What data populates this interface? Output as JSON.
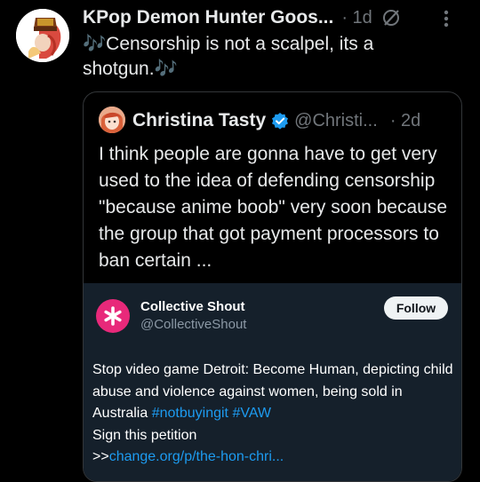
{
  "post": {
    "author_name": "KPop Demon Hunter Goos...",
    "time": "· 1d",
    "text": "🎶Censorship is not a scalpel, its a shotgun.🎶",
    "icons": {
      "grok": "grok-icon",
      "more": "more-icon"
    }
  },
  "quote": {
    "author_name": "Christina Tasty",
    "handle": "@Christi...",
    "time": "· 2d",
    "text": "I think people are gonna have to get very used to the idea of defending censorship \"because anime boob\" very soon because the group that got payment processors to ban certain ..."
  },
  "card": {
    "name": "Collective Shout",
    "handle": "@CollectiveShout",
    "follow_label": "Follow",
    "text_main": "Stop video game Detroit: Become Human, depicting child abuse and violence against women, being sold in Australia ",
    "hashtag1": "#notbuyingit",
    "hashtag2": "#VAW",
    "petition": "Sign this petition",
    "link_prefix": ">>",
    "link": "change.org/p/the-hon-chri..."
  },
  "colors": {
    "background": "#000000",
    "card_background": "#15202b",
    "link": "#1d9bf0",
    "verified": "#1d9bf0",
    "brand_pink": "#e8297a"
  }
}
